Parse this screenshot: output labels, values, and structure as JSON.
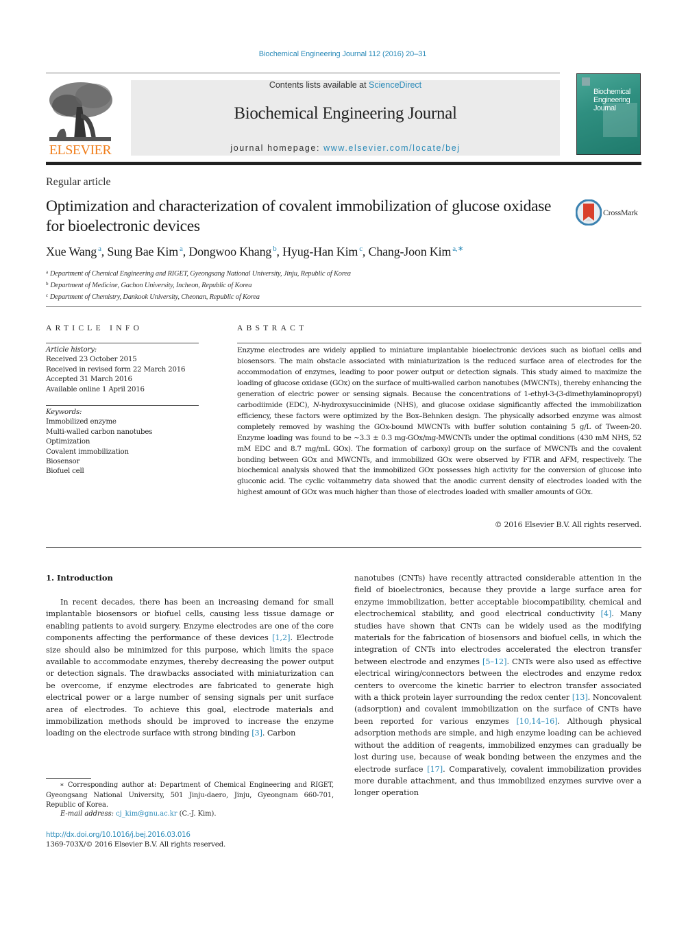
{
  "header": {
    "journal_ref": "Biochemical Engineering Journal 112 (2016) 20–31",
    "contents_prefix": "Contents lists available at ",
    "contents_link": "ScienceDirect",
    "journal_title": "Biochemical Engineering Journal",
    "homepage_prefix": "journal homepage: ",
    "homepage_link": "www.elsevier.com/locate/bej",
    "publisher_logo": "ELSEVIER",
    "cover_title_lines": [
      "Biochemical",
      "Engineering",
      "Journal"
    ],
    "crossmark_label": "CrossMark"
  },
  "article": {
    "type": "Regular article",
    "title": "Optimization and characterization of covalent immobilization of glucose oxidase for bioelectronic devices",
    "authors": [
      {
        "name": "Xue Wang",
        "sup": "a"
      },
      {
        "name": "Sung Bae Kim",
        "sup": "a"
      },
      {
        "name": "Dongwoo Khang",
        "sup": "b"
      },
      {
        "name": "Hyug-Han Kim",
        "sup": "c"
      },
      {
        "name": "Chang-Joon Kim",
        "sup": "a,∗"
      }
    ],
    "affiliations": [
      {
        "sup": "a",
        "text": "Department of Chemical Engineering and RIGET, Gyeongsang National University, Jinju, Republic of Korea"
      },
      {
        "sup": "b",
        "text": "Department of Medicine, Gachon University, Incheon, Republic of Korea"
      },
      {
        "sup": "c",
        "text": "Department of Chemistry, Dankook University, Cheonan, Republic of Korea"
      }
    ]
  },
  "article_info": {
    "heading": "ARTICLE INFO",
    "history_label": "Article history:",
    "history": [
      "Received 23 October 2015",
      "Received in revised form 22 March 2016",
      "Accepted 31 March 2016",
      "Available online 1 April 2016"
    ],
    "keywords_label": "Keywords:",
    "keywords": [
      "Immobilized enzyme",
      "Multi-walled carbon nanotubes",
      "Optimization",
      "Covalent immobilization",
      "Biosensor",
      "Biofuel cell"
    ]
  },
  "abstract": {
    "heading": "ABSTRACT",
    "text_1": "Enzyme electrodes are widely applied to miniature implantable bioelectronic devices such as biofuel cells and biosensors. The main obstacle associated with miniaturization is the reduced surface area of electrodes for the accommodation of enzymes, leading to poor power output or detection signals. This study aimed to maximize the loading of glucose oxidase (GOx) on the surface of multi-walled carbon nanotubes (MWCNTs), thereby enhancing the generation of electric power or sensing signals. Because the concentrations of 1-ethyl-3-(3-dimethylaminopropyl) carbodiimide (EDC), ",
    "text_italic": "N",
    "text_2": "-hydroxysuccinimide (NHS), and glucose oxidase significantly affected the immobilization efficiency, these factors were optimized by the Box–Behnken design. The physically adsorbed enzyme was almost completely removed by washing the GOx-bound MWCNTs with buffer solution containing 5 g/L of Tween-20. Enzyme loading was found to be ~3.3 ± 0.3 mg-GOx/mg-MWCNTs under the optimal conditions (430 mM NHS, 52 mM EDC and 8.7 mg/mL GOx). The formation of carboxyl group on the surface of MWCNTs and the covalent bonding between GOx and MWCNTs, and immobilized GOx were observed by FTIR and AFM, respectively. The biochemical analysis showed that the immobilized GOx possesses high activity for the conversion of glucose into gluconic acid. The cyclic voltammetry data showed that the anodic current density of electrodes loaded with the highest amount of GOx was much higher than those of electrodes loaded with smaller amounts of GOx.",
    "copyright": "© 2016 Elsevier B.V. All rights reserved."
  },
  "introduction": {
    "heading": "1.  Introduction",
    "left": [
      {
        "t": "In recent decades, there has been an increasing demand for small implantable biosensors or biofuel cells, causing less tissue damage or enabling patients to avoid surgery. Enzyme electrodes are one of the core components affecting the performance of these devices "
      },
      {
        "ref": "[1,2]"
      },
      {
        "t": ". Electrode size should also be minimized for this purpose, which limits the space available to accommodate enzymes, thereby decreasing the power output or detection signals. The drawbacks associated with miniaturization can be overcome, if enzyme electrodes are fabricated to generate high electrical power or a large number of sensing signals per unit surface area of electrodes. To achieve this goal, electrode materials and immobilization methods should be improved to increase the enzyme loading on the electrode surface with strong binding "
      },
      {
        "ref": "[3]"
      },
      {
        "t": ". Carbon"
      }
    ],
    "right": [
      {
        "t": "nanotubes (CNTs) have recently attracted considerable attention in the field of bioelectronics, because they provide a large surface area for enzyme immobilization, better acceptable biocompatibility, chemical and electrochemical stability, and good electrical conductivity "
      },
      {
        "ref": "[4]"
      },
      {
        "t": ". Many studies have shown that CNTs can be widely used as the modifying materials for the fabrication of biosensors and biofuel cells, in which the integration of CNTs into electrodes accelerated the electron transfer between electrode and enzymes "
      },
      {
        "ref": "[5–12]"
      },
      {
        "t": ". CNTs were also used as effective electrical wiring/connectors between the electrodes and enzyme redox centers to overcome the kinetic barrier to electron transfer associated with a thick protein layer surrounding the redox center "
      },
      {
        "ref": "[13]"
      },
      {
        "t": ". Noncovalent (adsorption) and covalent immobilization on the surface of CNTs have been reported for various enzymes "
      },
      {
        "ref": "[10,14–16]"
      },
      {
        "t": ". Although physical adsorption methods are simple, and high enzyme loading can be achieved without the addition of reagents, immobilized enzymes can gradually be lost during use, because of weak bonding between the enzymes and the electrode surface "
      },
      {
        "ref": "[17]"
      },
      {
        "t": ". Comparatively, covalent immobilization provides more durable attachment, and thus immobilized enzymes survive over a longer operation"
      }
    ]
  },
  "footnotes": {
    "corresponding": "∗ Corresponding author at: Department of Chemical Engineering and RIGET, Gyeongsang National University, 501 Jinju-daero, Jinju, Gyeongnam 660-701, Republic of Korea.",
    "email_label": "E-mail address: ",
    "email": "cj_kim@gnu.ac.kr",
    "email_suffix": " (C.-J. Kim).",
    "doi": "http://dx.doi.org/10.1016/j.bej.2016.03.016",
    "issn": "1369-703X/© 2016 Elsevier B.V. All rights reserved."
  },
  "colors": {
    "link": "#2a8ab8",
    "elsevier_orange": "#f07d1a",
    "banner_bg": "#ebebeb",
    "cover_teal": "#2f8f80",
    "crossmark_red": "#d9402b"
  }
}
